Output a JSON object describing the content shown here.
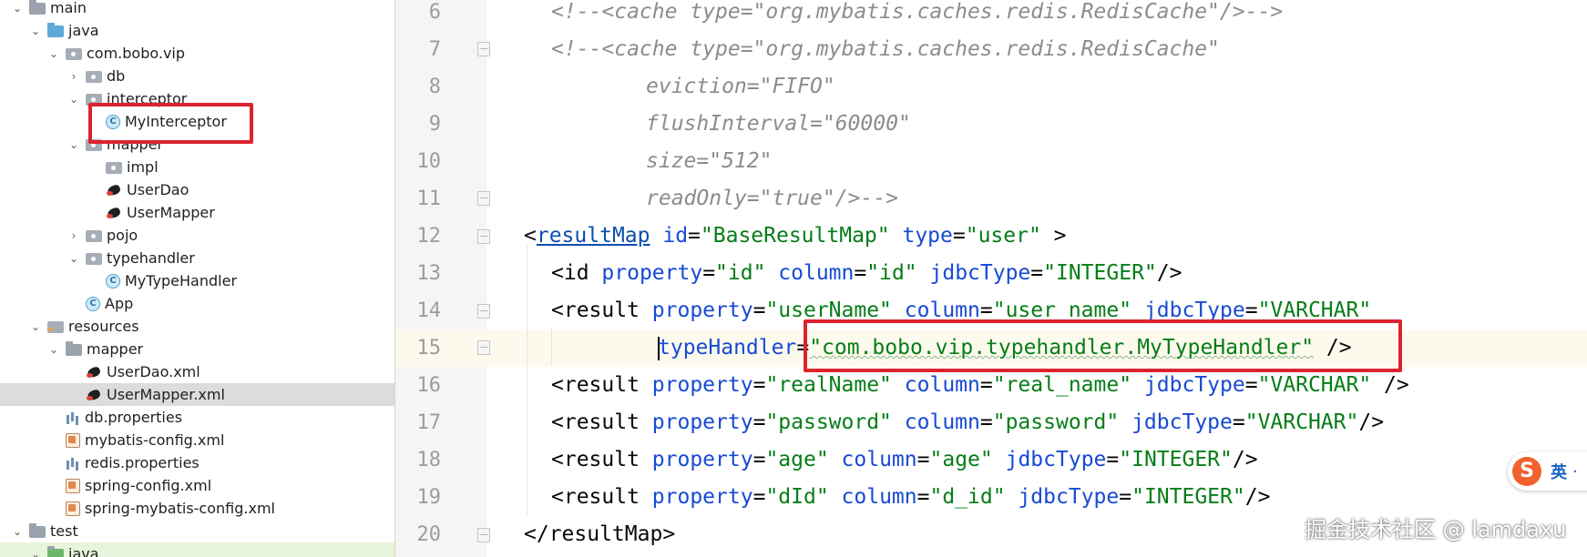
{
  "project_tree": {
    "items": [
      {
        "label": "main",
        "icon": "folder-icon"
      },
      {
        "label": "java",
        "icon": "source-folder-icon"
      },
      {
        "label": "com.bobo.vip",
        "icon": "package-icon"
      },
      {
        "label": "db",
        "icon": "package-icon"
      },
      {
        "label": "interceptor",
        "icon": "package-icon"
      },
      {
        "label": "MyInterceptor",
        "icon": "java-class-icon"
      },
      {
        "label": "mapper",
        "icon": "package-icon"
      },
      {
        "label": "impl",
        "icon": "package-icon"
      },
      {
        "label": "UserDao",
        "icon": "mybatis-interface-icon"
      },
      {
        "label": "UserMapper",
        "icon": "mybatis-interface-icon"
      },
      {
        "label": "pojo",
        "icon": "package-icon"
      },
      {
        "label": "typehandler",
        "icon": "package-icon"
      },
      {
        "label": "MyTypeHandler",
        "icon": "java-class-icon"
      },
      {
        "label": "App",
        "icon": "java-main-class-icon"
      },
      {
        "label": "resources",
        "icon": "resources-folder-icon"
      },
      {
        "label": "mapper",
        "icon": "folder-icon"
      },
      {
        "label": "UserDao.xml",
        "icon": "mybatis-xml-icon"
      },
      {
        "label": "UserMapper.xml",
        "icon": "mybatis-xml-icon"
      },
      {
        "label": "db.properties",
        "icon": "properties-file-icon"
      },
      {
        "label": "mybatis-config.xml",
        "icon": "xml-file-icon"
      },
      {
        "label": "redis.properties",
        "icon": "properties-file-icon"
      },
      {
        "label": "spring-config.xml",
        "icon": "xml-file-icon"
      },
      {
        "label": "spring-mybatis-config.xml",
        "icon": "xml-file-icon"
      },
      {
        "label": "test",
        "icon": "folder-icon"
      },
      {
        "label": "java",
        "icon": "test-source-folder-icon"
      }
    ],
    "selected_item": "UserMapper.xml"
  },
  "editor": {
    "line_numbers": [
      "6",
      "7",
      "8",
      "9",
      "10",
      "11",
      "12",
      "13",
      "14",
      "15",
      "16",
      "17",
      "18",
      "19",
      "20"
    ],
    "current_line": "15",
    "lines": {
      "l6": {
        "comment": "<!--<cache type=\"org.mybatis.caches.redis.RedisCache\"/>-->"
      },
      "l7": {
        "comment": "<!--<cache type=\"org.mybatis.caches.redis.RedisCache\""
      },
      "l8": {
        "comment": "eviction=\"FIFO\""
      },
      "l9": {
        "comment": "flushInterval=\"60000\""
      },
      "l10": {
        "comment": "size=\"512\""
      },
      "l11": {
        "comment": "readOnly=\"true\"/>-->"
      },
      "l12": {
        "open": "<",
        "tag": "resultMap",
        "a1": "id",
        "v1": "\"BaseResultMap\"",
        "a2": "type",
        "v2": "\"user\"",
        "close": " >"
      },
      "l13": {
        "open": "<id",
        "a1": "property",
        "v1": "\"id\"",
        "a2": "column",
        "v2": "\"id\"",
        "a3": "jdbcType",
        "v3": "\"INTEGER\"",
        "close": "/>"
      },
      "l14": {
        "open": "<result",
        "a1": "property",
        "v1": "\"userName\"",
        "a2": "column",
        "v2": "\"user_name\"",
        "a3": "jdbcType",
        "v3": "\"VARCHAR\""
      },
      "l15": {
        "a1": "typeHandler",
        "v1": "\"com.bobo.vip.typehandler.MyTypeHandler\"",
        "close": " />"
      },
      "l16": {
        "open": "<result",
        "a1": "property",
        "v1": "\"realName\"",
        "a2": "column",
        "v2": "\"real_name\"",
        "a3": "jdbcType",
        "v3": "\"VARCHAR\"",
        "close": " />"
      },
      "l17": {
        "open": "<result",
        "a1": "property",
        "v1": "\"password\"",
        "a2": "column",
        "v2": "\"password\"",
        "a3": "jdbcType",
        "v3": "\"VARCHAR\"",
        "close": "/>"
      },
      "l18": {
        "open": "<result",
        "a1": "property",
        "v1": "\"age\"",
        "a2": "column",
        "v2": "\"age\"",
        "a3": "jdbcType",
        "v3": "\"INTEGER\"",
        "close": "/>"
      },
      "l19": {
        "open": "<result",
        "a1": "property",
        "v1": "\"dId\"",
        "a2": "column",
        "v2": "\"d_id\"",
        "a3": "jdbcType",
        "v3": "\"INTEGER\"",
        "close": "/>"
      },
      "l20": {
        "open": "</resultMap>"
      }
    }
  },
  "ime": {
    "logo": "S",
    "language": "英",
    "extra": "·"
  },
  "watermark": "掘金技术社区 @ lamdaxu",
  "colors": {
    "highlight_box": "#dc2330",
    "xml_attribute": "#174ad4",
    "xml_value": "#067d17",
    "comment": "#8c8c8c"
  }
}
